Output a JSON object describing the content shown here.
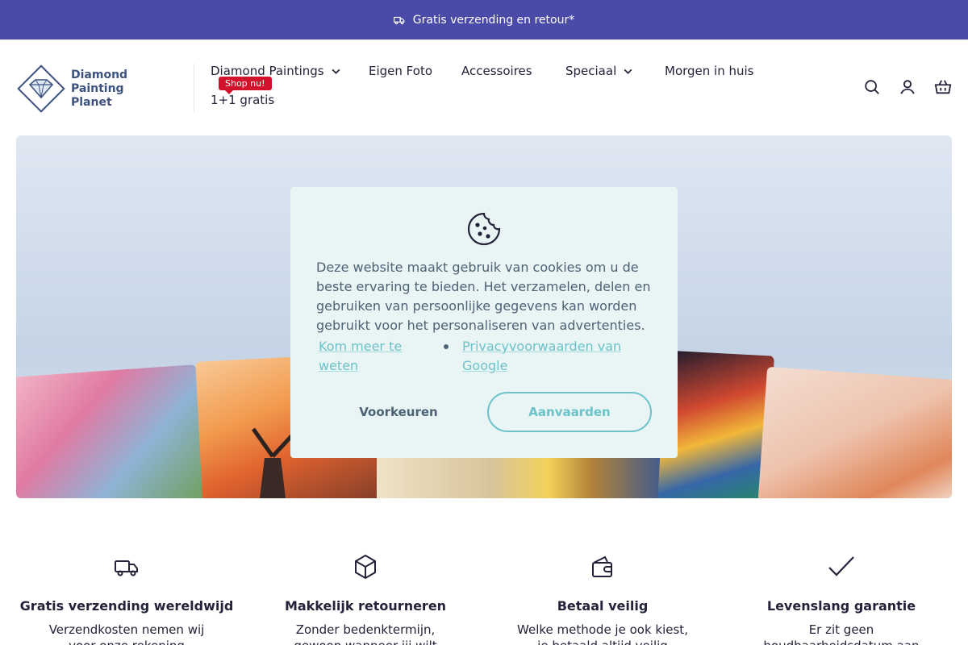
{
  "topbar": {
    "text": "Gratis verzending en retour*",
    "icon": "truck-icon"
  },
  "logo": {
    "line1": "Diamond",
    "line2": "Painting",
    "line3": "Planet"
  },
  "nav": {
    "items": [
      {
        "label": "Diamond Paintings",
        "has_dropdown": true
      },
      {
        "label": "Eigen Foto",
        "has_dropdown": false
      },
      {
        "label": "Accessoires",
        "has_dropdown": false
      },
      {
        "label": "Speciaal",
        "has_dropdown": true
      },
      {
        "label": "Morgen in huis",
        "has_dropdown": false
      },
      {
        "label": "1+1 gratis",
        "has_dropdown": false
      }
    ],
    "badge": "Shop nu!"
  },
  "header_icons": [
    "search-icon",
    "account-icon",
    "basket-icon"
  ],
  "cookie": {
    "text": "Deze website maakt gebruik van cookies om u de beste ervaring te bieden. Het verzamelen, delen en gebruiken van persoonlijke gegevens kan worden gebruikt voor het personaliseren van advertenties.",
    "link_more": "Kom meer te weten",
    "link_privacy": "Privacyvoorwaarden van Google",
    "btn_preferences": "Voorkeuren",
    "btn_accept": "Aanvaarden"
  },
  "features": [
    {
      "title": "Gratis verzending wereldwijd",
      "desc": "Verzendkosten nemen wij voor onze rekening",
      "icon": "truck-icon"
    },
    {
      "title": "Makkelijk retourneren",
      "desc": "Zonder bedenktermijn, gewoon wanneer jij wilt",
      "icon": "box-icon"
    },
    {
      "title": "Betaal veilig",
      "desc": "Welke methode je ook kiest, je betaald altijd veilig",
      "icon": "wallet-icon"
    },
    {
      "title": "Levenslang garantie",
      "desc": "Er zit geen houdbaarheidsdatum aan",
      "icon": "checkmark-icon"
    }
  ],
  "colors": {
    "topbar_bg": "#4a4aa8",
    "accent_teal": "#6bc3c9",
    "badge_red": "#d4112a",
    "cookie_bg": "#e9f4f5",
    "text_dark": "#23233a"
  }
}
